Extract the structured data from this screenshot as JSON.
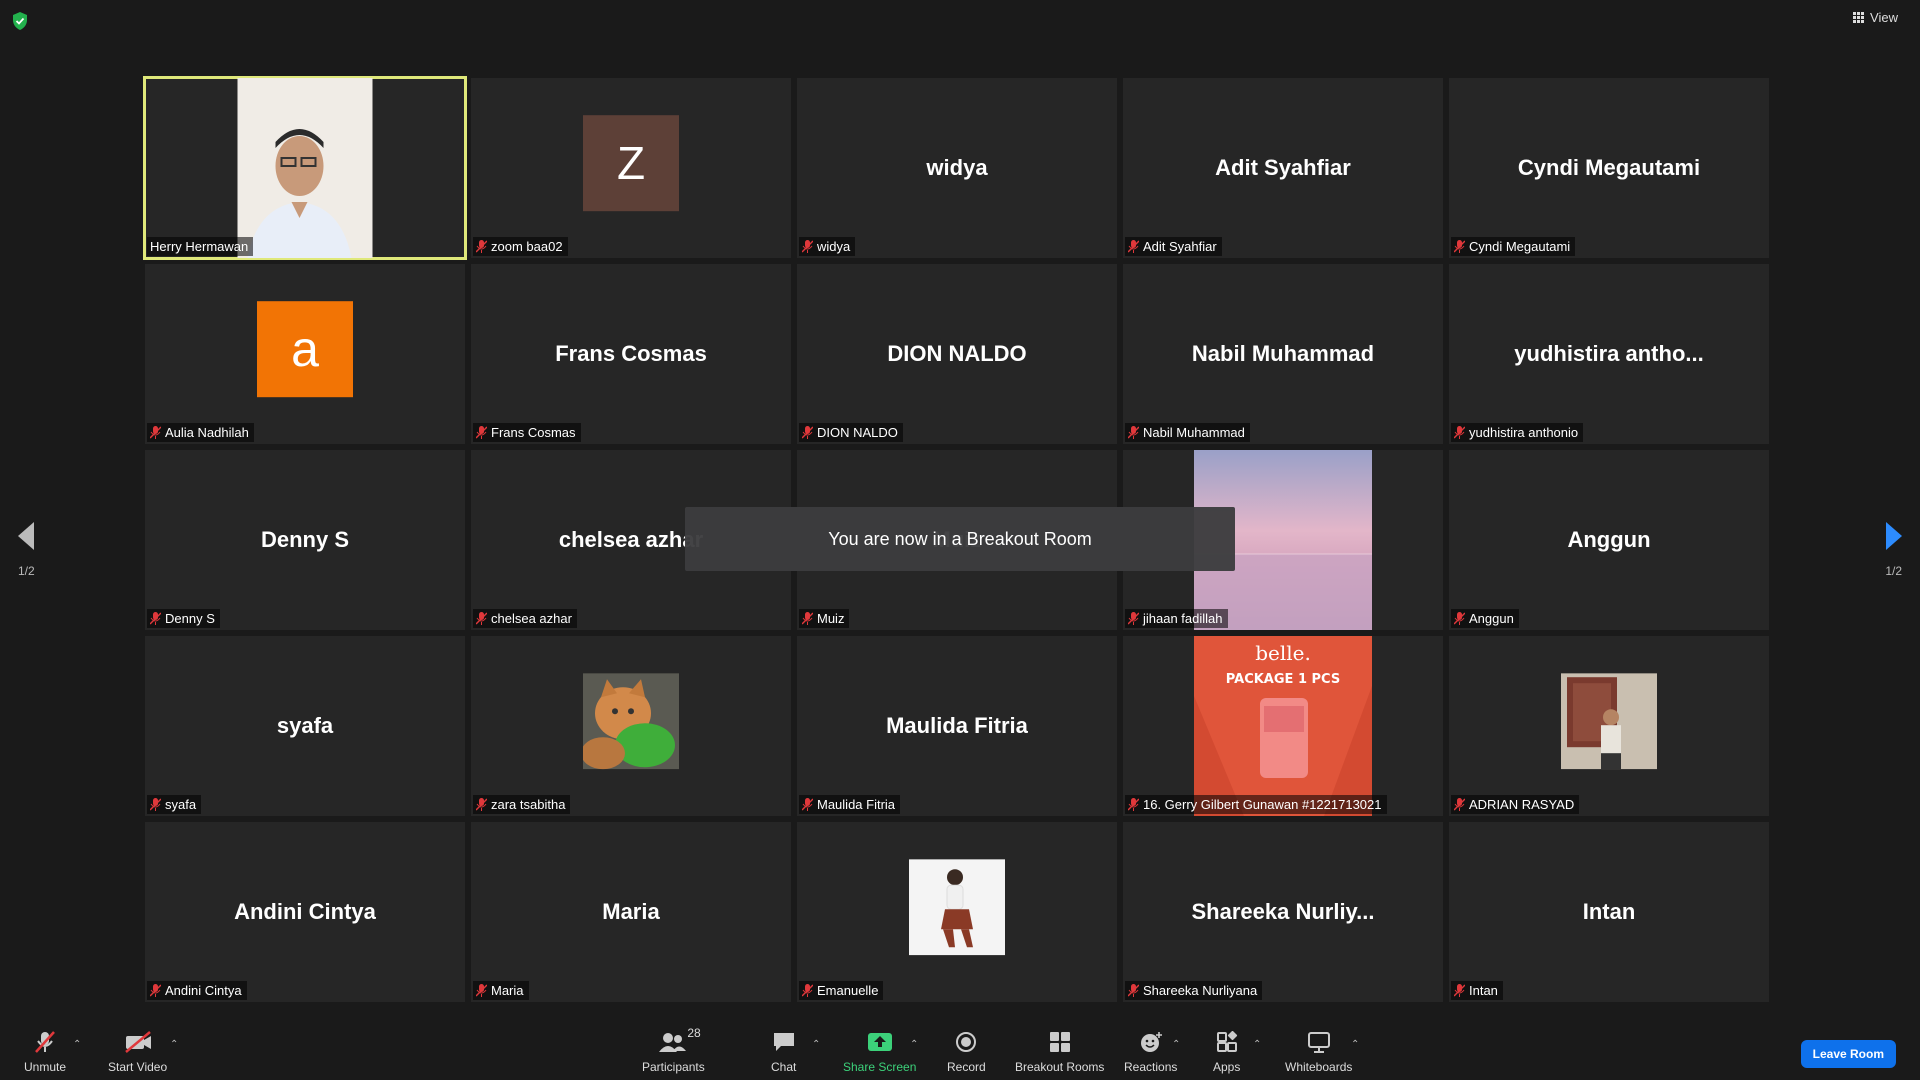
{
  "window": {
    "view_label": "View",
    "breakout_toast": "You are now in a Breakout Room",
    "page_left": "1/2",
    "page_right": "1/2"
  },
  "colors": {
    "active_speaker_border": "#dfe87a",
    "muted_icon": "#e0383b",
    "share_screen_green": "#3cd17a",
    "leave_button": "#0e71eb",
    "avatar_z": "#5d4037",
    "avatar_a": "#f27405"
  },
  "tiles": [
    {
      "label": "Herry Hermawan",
      "type": "video",
      "muted": false
    },
    {
      "label": "zoom baa02",
      "type": "avatar",
      "avatar_letter": "Z",
      "muted": true
    },
    {
      "label": "widya",
      "display": "widya",
      "type": "name",
      "muted": true
    },
    {
      "label": "Adit Syahfiar",
      "display": "Adit Syahfiar",
      "type": "name",
      "muted": true
    },
    {
      "label": "Cyndi Megautami",
      "display": "Cyndi Megautami",
      "type": "name",
      "muted": true
    },
    {
      "label": "Aulia Nadhilah",
      "type": "avatar",
      "avatar_letter": "a",
      "muted": true
    },
    {
      "label": "Frans Cosmas",
      "display": "Frans Cosmas",
      "type": "name",
      "muted": true
    },
    {
      "label": "DION NALDO",
      "display": "DION NALDO",
      "type": "name",
      "muted": true
    },
    {
      "label": "Nabil Muhammad",
      "display": "Nabil Muhammad",
      "type": "name",
      "muted": true
    },
    {
      "label": "yudhistira anthonio",
      "display": "yudhistira antho...",
      "type": "name",
      "muted": true
    },
    {
      "label": "Denny S",
      "display": "Denny S",
      "type": "name",
      "muted": true
    },
    {
      "label": "chelsea azhar",
      "display": "chelsea azhar",
      "type": "name",
      "muted": true
    },
    {
      "label": "Muiz",
      "display": "Muiz",
      "type": "name",
      "muted": true
    },
    {
      "label": "jihaan fadillah",
      "type": "picture",
      "muted": true
    },
    {
      "label": "Anggun",
      "display": "Anggun",
      "type": "name",
      "muted": true
    },
    {
      "label": "syafa",
      "display": "syafa",
      "type": "name",
      "muted": true
    },
    {
      "label": "zara tsabitha",
      "type": "picture",
      "muted": true
    },
    {
      "label": "Maulida Fitria",
      "display": "Maulida Fitria",
      "type": "name",
      "muted": true
    },
    {
      "label": "16. Gerry Gilbert Gunawan #1221713021",
      "type": "picture",
      "ad_brand": "belle.",
      "ad_text": "PACKAGE 1 PCS",
      "muted": true
    },
    {
      "label": "ADRIAN RASYAD",
      "type": "picture",
      "muted": true
    },
    {
      "label": "Andini Cintya",
      "display": "Andini Cintya",
      "type": "name",
      "muted": true
    },
    {
      "label": "Maria",
      "display": "Maria",
      "type": "name",
      "muted": true
    },
    {
      "label": "Emanuelle",
      "type": "picture",
      "muted": true
    },
    {
      "label": "Shareeka Nurliyana",
      "display": "Shareeka  Nurliy...",
      "type": "name",
      "muted": true
    },
    {
      "label": "Intan",
      "display": "Intan",
      "type": "name",
      "muted": true
    }
  ],
  "toolbar": {
    "unmute": "Unmute",
    "start_video": "Start Video",
    "participants": "Participants",
    "participants_count": "28",
    "chat": "Chat",
    "share_screen": "Share Screen",
    "record": "Record",
    "breakout_rooms": "Breakout Rooms",
    "reactions": "Reactions",
    "apps": "Apps",
    "whiteboards": "Whiteboards",
    "leave_room": "Leave Room"
  }
}
